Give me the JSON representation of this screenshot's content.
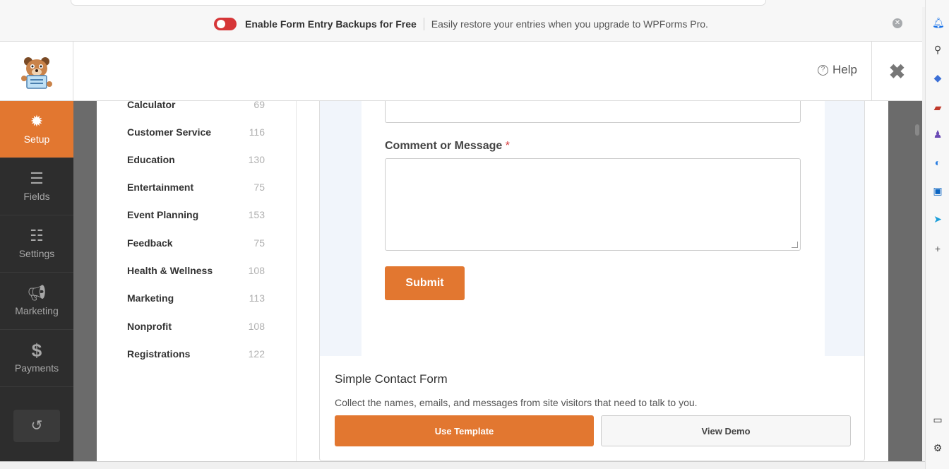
{
  "banner": {
    "title": "Enable Form Entry Backups for Free",
    "subtitle": "Easily restore your entries when you upgrade to WPForms Pro."
  },
  "header": {
    "help_label": "Help"
  },
  "sidebar": {
    "items": [
      {
        "label": "Setup",
        "icon": "gear-icon",
        "active": true
      },
      {
        "label": "Fields",
        "icon": "fields-list-icon",
        "active": false
      },
      {
        "label": "Settings",
        "icon": "sliders-icon",
        "active": false
      },
      {
        "label": "Marketing",
        "icon": "megaphone-icon",
        "active": false
      },
      {
        "label": "Payments",
        "icon": "dollar-icon",
        "active": false
      }
    ]
  },
  "categories": [
    {
      "name": "Calculator",
      "count": "69"
    },
    {
      "name": "Customer Service",
      "count": "116"
    },
    {
      "name": "Education",
      "count": "130"
    },
    {
      "name": "Entertainment",
      "count": "75"
    },
    {
      "name": "Event Planning",
      "count": "153"
    },
    {
      "name": "Feedback",
      "count": "75"
    },
    {
      "name": "Health & Wellness",
      "count": "108"
    },
    {
      "name": "Marketing",
      "count": "113"
    },
    {
      "name": "Nonprofit",
      "count": "108"
    },
    {
      "name": "Registrations",
      "count": "122"
    }
  ],
  "preview": {
    "field_label": "Comment or Message",
    "required_mark": "*",
    "submit_label": "Submit"
  },
  "template": {
    "title": "Simple Contact Form",
    "description": "Collect the names, emails, and messages from site visitors that need to talk to you.",
    "use_label": "Use Template",
    "demo_label": "View Demo"
  },
  "colors": {
    "accent": "#e27730",
    "sidebar_bg": "#2d2d2d",
    "toggle_off": "#d63638"
  }
}
